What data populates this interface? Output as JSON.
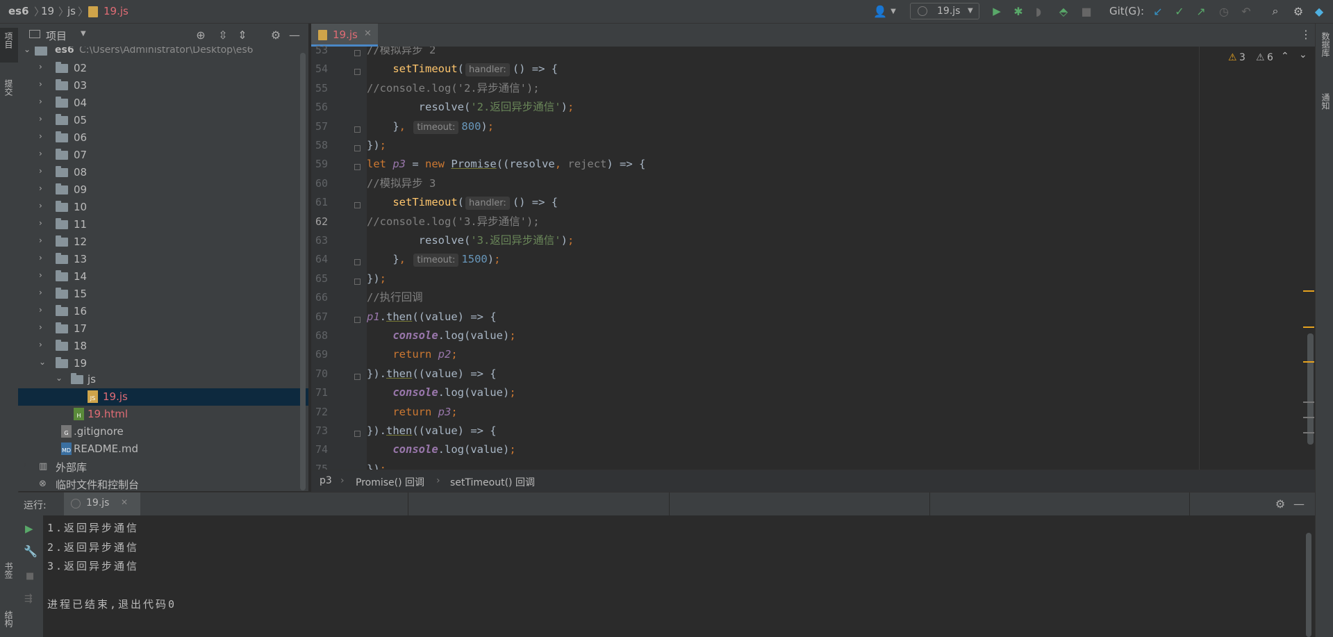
{
  "navbar": {
    "crumbs": [
      "es6",
      "19",
      "js",
      "19.js"
    ],
    "run_config": "19.js",
    "git_label": "Git(G):"
  },
  "left_stripe": {
    "project_tab": "项目",
    "commit_tab": "提交",
    "bookmarks_tab": "书签",
    "structure_tab": "结构"
  },
  "right_stripe": {
    "database_tab": "数据库",
    "notifications_tab": "通知"
  },
  "project_panel": {
    "title": "项目",
    "root_name": "es6",
    "root_path": "C:\\Users\\Administrator\\Desktop\\es6",
    "folders": [
      "02",
      "03",
      "04",
      "05",
      "06",
      "07",
      "08",
      "09",
      "10",
      "11",
      "12",
      "13",
      "14",
      "15",
      "16",
      "17",
      "18",
      "19"
    ],
    "subfolder": "js",
    "selected_file": "19.js",
    "files": [
      {
        "name": "19.html",
        "icon": "html-file-icon"
      },
      {
        "name": ".gitignore",
        "icon": "gitignore-file-icon"
      },
      {
        "name": "README.md",
        "icon": "markdown-file-icon"
      }
    ],
    "external_libs": "外部库",
    "scratches": "临时文件和控制台"
  },
  "editor": {
    "tab_label": "19.js",
    "warnings_count": "3",
    "weak_warnings_count": "6",
    "current_line": 62,
    "hints": {
      "handler": "handler:",
      "timeout": "timeout:"
    }
  },
  "breadcrumb": {
    "items": [
      "p3",
      "Promise() 回调",
      "setTimeout() 回调"
    ]
  },
  "run_panel": {
    "label": "运行:",
    "tab_label": "19.js",
    "output": [
      "1.返回异步通信",
      "2.返回异步通信",
      "3.返回异步通信",
      "",
      "进程已结束,退出代码0"
    ]
  },
  "colors": {
    "background": "#2b2b2b",
    "panel": "#3c3f41",
    "keyword": "#cc7832",
    "string": "#6a8759",
    "function": "#ffc66d",
    "number": "#6897bb",
    "comment": "#808080",
    "selection": "#0d293e",
    "accent": "#4a88c7",
    "warning": "#e5a21f"
  }
}
